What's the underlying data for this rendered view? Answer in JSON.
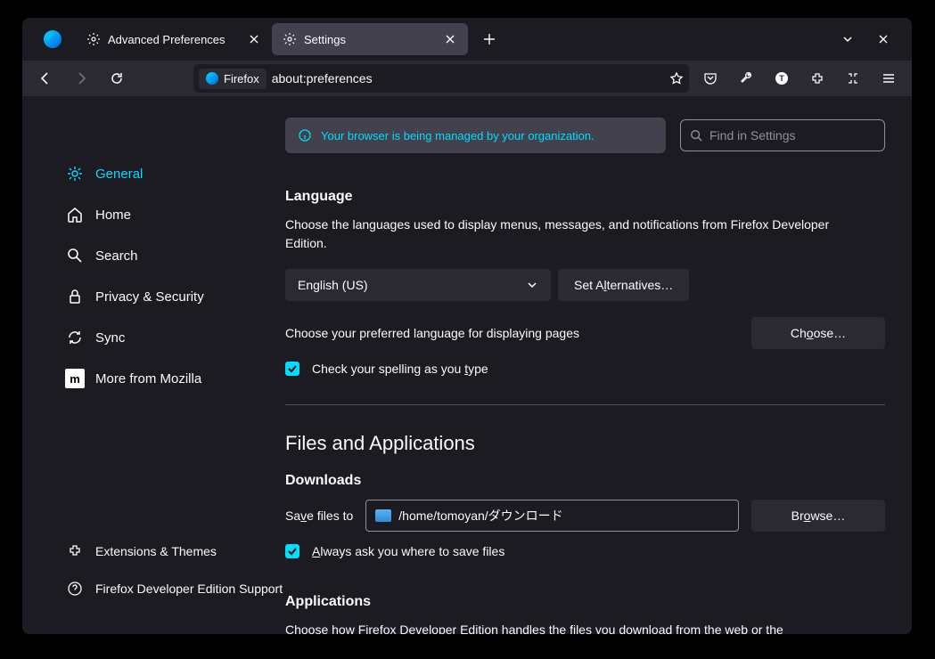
{
  "tabs": [
    {
      "title": "Advanced Preferences"
    },
    {
      "title": "Settings"
    }
  ],
  "url": {
    "identity": "Firefox",
    "path": "about:preferences"
  },
  "sidebar": {
    "items": [
      {
        "label": "General"
      },
      {
        "label": "Home"
      },
      {
        "label": "Search"
      },
      {
        "label": "Privacy & Security"
      },
      {
        "label": "Sync"
      },
      {
        "label": "More from Mozilla"
      }
    ],
    "bottom": [
      {
        "label": "Extensions & Themes"
      },
      {
        "label": "Firefox Developer Edition Support"
      }
    ]
  },
  "org_banner": "Your browser is being managed by your organization.",
  "search_placeholder": "Find in Settings",
  "language": {
    "heading": "Language",
    "desc": "Choose the languages used to display menus, messages, and notifications from Firefox Developer Edition.",
    "selected": "English (US)",
    "alt_btn_pre": "Set A",
    "alt_btn_u": "l",
    "alt_btn_post": "ternatives…",
    "pref_desc": "Choose your preferred language for displaying pages",
    "choose_pre": "Ch",
    "choose_u": "o",
    "choose_post": "ose…",
    "spell_pre": "Check your spelling as you ",
    "spell_u": "t",
    "spell_post": "ype"
  },
  "files_heading": "Files and Applications",
  "downloads": {
    "heading": "Downloads",
    "save_pre": "Sa",
    "save_u": "v",
    "save_post": "e files to",
    "path": "/home/tomoyan/ダウンロード",
    "browse_pre": "Br",
    "browse_u": "o",
    "browse_post": "wse…",
    "always_u": "A",
    "always_post": "lways ask you where to save files"
  },
  "applications": {
    "heading": "Applications",
    "desc": "Choose how Firefox Developer Edition handles the files you download from the web or the"
  }
}
